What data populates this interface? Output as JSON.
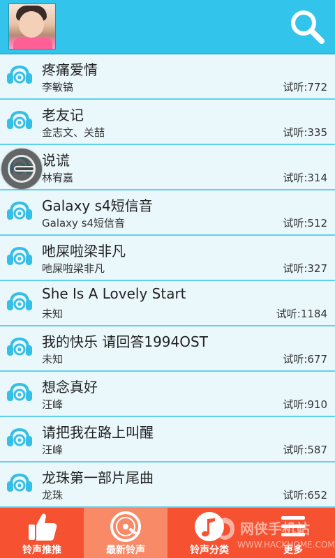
{
  "header": {
    "avatar_alt": "user-avatar",
    "search_icon": "search-icon"
  },
  "songs": [
    {
      "title": "疼痛爱情",
      "artist": "李敏镐",
      "plays": "试听:772"
    },
    {
      "title": "老友记",
      "artist": "金志文、关喆",
      "plays": "试听:335"
    },
    {
      "title": "说谎",
      "artist": "林宥嘉",
      "plays": "试听:314"
    },
    {
      "title": "Galaxy s4短信音",
      "artist": "Galaxy s4短信音",
      "plays": "试听:512"
    },
    {
      "title": "吔屎啦梁非凡",
      "artist": "吔屎啦梁非凡",
      "plays": "试听:327"
    },
    {
      "title": "She Is A Lovely Start",
      "artist": "未知",
      "plays": "试听:1184"
    },
    {
      "title": "我的快乐 请回答1994OST",
      "artist": "未知",
      "plays": "试听:677"
    },
    {
      "title": "想念真好",
      "artist": "汪峰",
      "plays": "试听:910"
    },
    {
      "title": "请把我在路上叫醒",
      "artist": "汪峰",
      "plays": "试听:587"
    },
    {
      "title": "龙珠第一部片尾曲",
      "artist": "龙珠",
      "plays": "试听:652"
    }
  ],
  "tabs": [
    {
      "label": "铃声推推",
      "icon": "thumbs-up-icon",
      "active": false
    },
    {
      "label": "最新铃声",
      "icon": "disc-icon",
      "active": true
    },
    {
      "label": "铃声分类",
      "icon": "music-note-icon",
      "active": false
    },
    {
      "label": "更多",
      "icon": "menu-icon",
      "active": false
    }
  ],
  "watermark": {
    "cn": "网侠手机站",
    "en": "WWW.HACKHOME.COM"
  },
  "colors": {
    "header": "#33c4ec",
    "tabbar": "#f65232",
    "tab_active": "#f88a68",
    "row_divider": "#5fd0ee",
    "ear_icon": "#35bfe6"
  }
}
